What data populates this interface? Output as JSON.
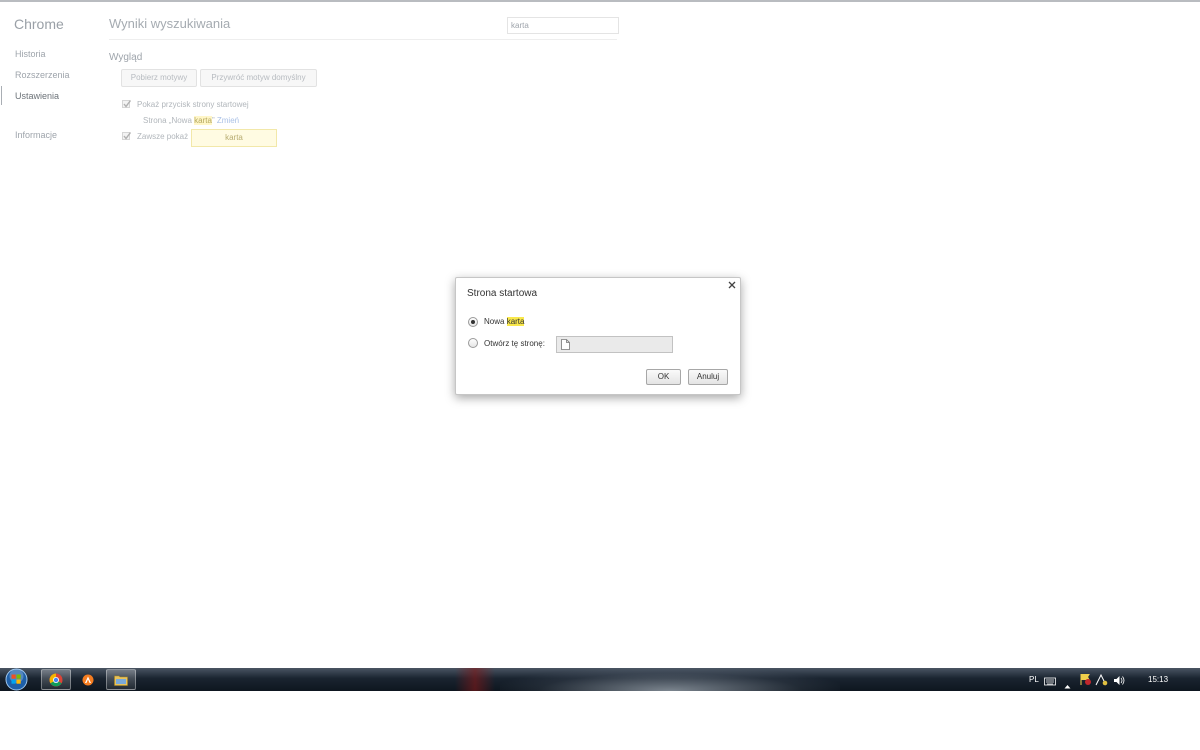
{
  "brand": "Chrome",
  "nav": {
    "items": [
      "Historia",
      "Rozszerzenia",
      "Ustawienia",
      "Informacje"
    ],
    "selected": "Ustawienia"
  },
  "header": {
    "title": "Wyniki wyszukiwania",
    "search_value": "karta"
  },
  "appearance": {
    "section_title": "Wygląd",
    "get_themes_label": "Pobierz motywy",
    "reset_theme_label": "Przywróć motyw domyślny",
    "show_home_label": "Pokaż przycisk strony startowej",
    "home_prefix": "Strona „Nowa",
    "home_highlight": "karta",
    "home_suffix": "”",
    "home_change_link": "Zmień",
    "always_show_label": "Zawsze pokaż",
    "search_bubble": "karta"
  },
  "dialog": {
    "title": "Strona startowa",
    "option1_prefix": "Nowa",
    "option1_highlight": "karta",
    "option2_label": "Otwórz tę stronę:",
    "url_value": "",
    "ok_label": "OK",
    "cancel_label": "Anuluj",
    "selected_option": "new-tab"
  },
  "taskbar": {
    "language": "PL",
    "time": "15:13"
  },
  "colors": {
    "highlight": "#f9e84b",
    "link": "#a9c0e6",
    "taskbar": "#1a2430"
  },
  "icons": [
    "start-orb-icon",
    "chrome-icon",
    "avast-icon",
    "explorer-folder-icon",
    "keyboard-icon",
    "tray-arrow-icon",
    "security-flag-icon",
    "network-icon",
    "volume-icon",
    "page-icon",
    "close-icon"
  ]
}
